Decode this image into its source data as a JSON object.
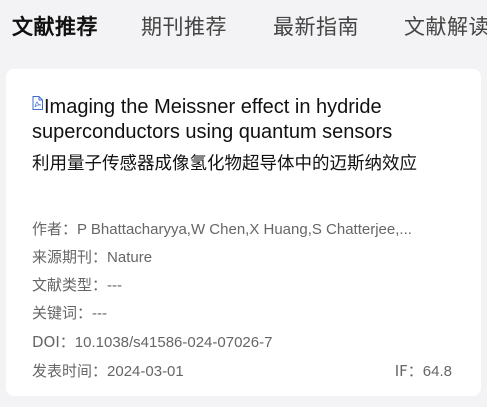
{
  "tabs": [
    {
      "label": "文献推荐",
      "active": true
    },
    {
      "label": "期刊推荐",
      "active": false
    },
    {
      "label": "最新指南",
      "active": false
    },
    {
      "label": "文献解读",
      "active": false
    }
  ],
  "article": {
    "title_en": "Imaging the Meissner effect in hydride superconductors using quantum sensors",
    "title_zh": "利用量子传感器成像氢化物超导体中的迈斯纳效应",
    "authors_label": "作者：",
    "authors": "P Bhattacharyya,W Chen,X Huang,S Chatterjee,...",
    "journal_label": "来源期刊：",
    "journal": "Nature",
    "type_label": "文献类型：",
    "type": "---",
    "keywords_label": "关键词：",
    "keywords": "---",
    "doi_label": "DOI：",
    "doi": "10.1038/s41586-024-07026-7",
    "date_label": "发表时间：",
    "date": "2024-03-01",
    "if_label": "IF：",
    "if_value": "64.8"
  },
  "colors": {
    "background": "#f3f3f5",
    "card": "#ffffff",
    "pdf_icon": "#3c6fd1"
  },
  "icons": {
    "pdf": "pdf-file-icon"
  }
}
